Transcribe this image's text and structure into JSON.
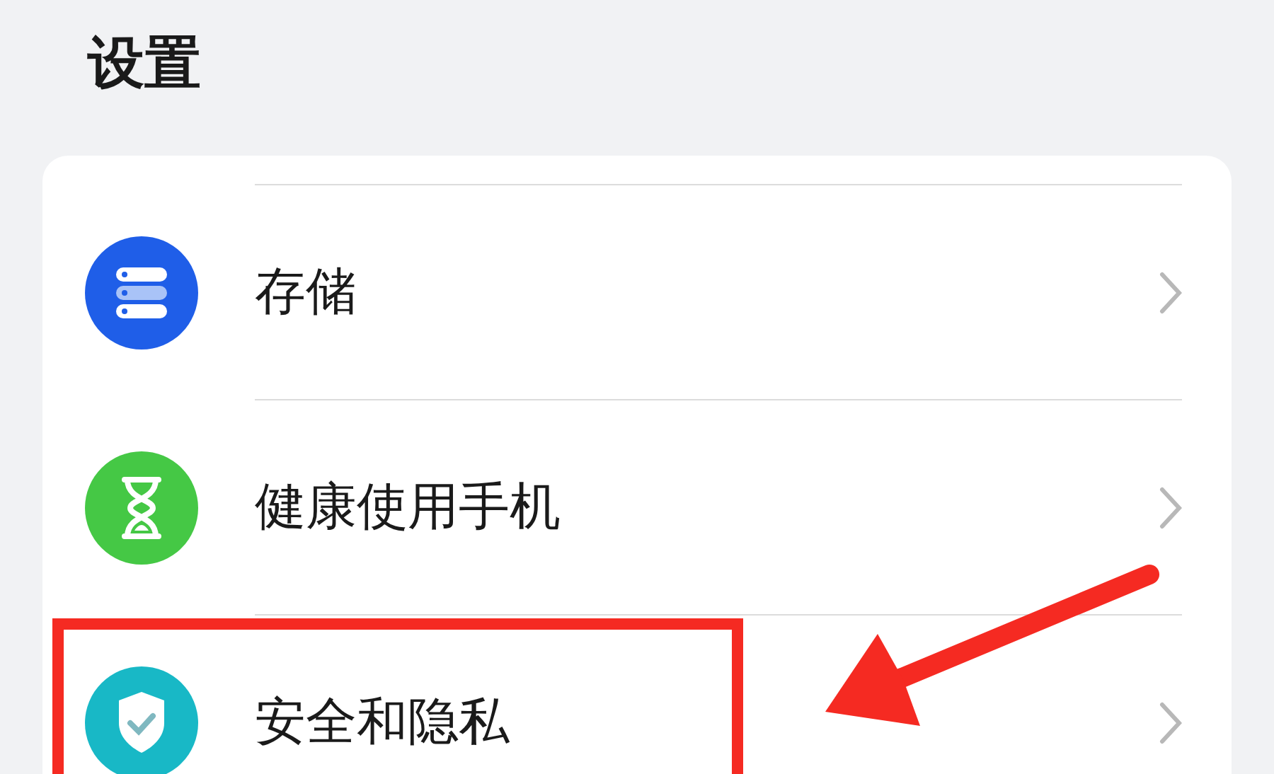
{
  "title": "设置",
  "items": [
    {
      "label": "存储",
      "kind": "storage",
      "highlighted": false
    },
    {
      "label": "健康使用手机",
      "kind": "hourglass",
      "highlighted": false
    },
    {
      "label": "安全和隐私",
      "kind": "shield",
      "highlighted": true
    }
  ]
}
